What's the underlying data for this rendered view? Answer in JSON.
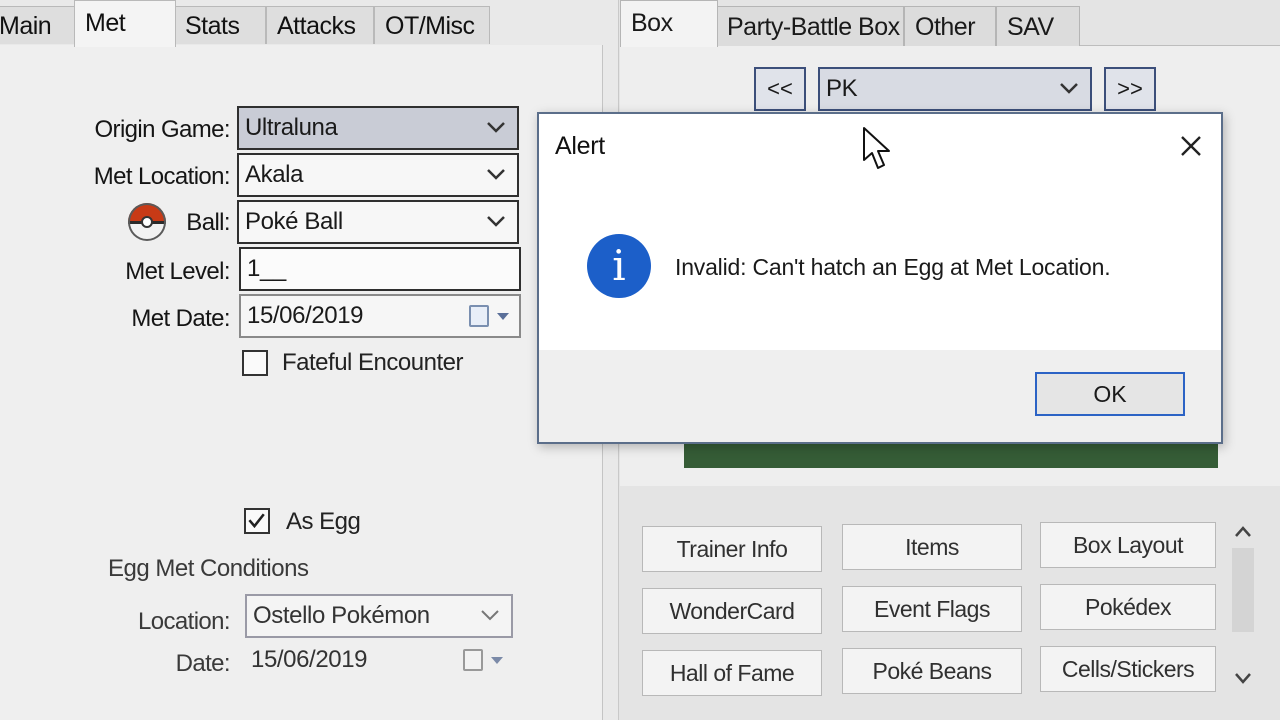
{
  "left_tabs": [
    "Main",
    "Met",
    "Stats",
    "Attacks",
    "OT/Misc"
  ],
  "right_tabs": [
    "Box",
    "Party-Battle Box",
    "Other",
    "SAV"
  ],
  "met": {
    "origin_game_label": "Origin Game:",
    "origin_game_value": "Ultraluna",
    "met_location_label": "Met Location:",
    "met_location_value": "Akala",
    "ball_label": "Ball:",
    "ball_value": "Poké Ball",
    "met_level_label": "Met Level:",
    "met_level_value": "1__",
    "met_date_label": "Met Date:",
    "met_date_value": "15/06/2019",
    "fateful_label": "Fateful Encounter",
    "fateful_checked": false,
    "as_egg_label": "As Egg",
    "as_egg_checked": true,
    "egg_conditions_label": "Egg Met Conditions",
    "egg_location_label": "Location:",
    "egg_location_value": "Ostello Pokémon",
    "egg_date_label": "Date:",
    "egg_date_value": "15/06/2019"
  },
  "box": {
    "prev_label": "<<",
    "next_label": ">>",
    "box_name": "PK"
  },
  "tools": [
    "Trainer Info",
    "Items",
    "Box Layout",
    "WonderCard",
    "Event Flags",
    "Pokédex",
    "Hall of Fame",
    "Poké Beans",
    "Cells/Stickers"
  ],
  "dialog": {
    "title": "Alert",
    "message": "Invalid: Can't hatch an Egg at Met Location.",
    "ok_label": "OK",
    "icon_glyph": "i"
  },
  "colors": {
    "dialog_border": "#5b6e8a",
    "info_icon": "#1c5fc9",
    "ok_focus": "#2c63c5",
    "box_green": "#355c36"
  }
}
